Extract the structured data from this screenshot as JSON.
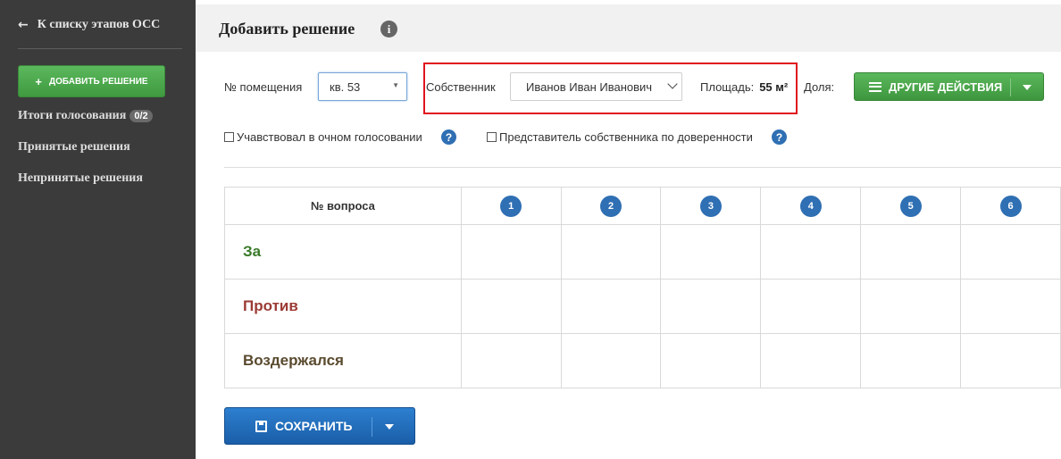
{
  "sidebar": {
    "back_label": "К списку этапов ОСС",
    "add_button_label": "ДОБАВИТЬ РЕШЕНИЕ",
    "items": [
      {
        "label": "Итоги голосования",
        "badge": "0/2"
      },
      {
        "label": "Принятые решения"
      },
      {
        "label": "Непринятые решения"
      }
    ]
  },
  "header": {
    "title": "Добавить решение"
  },
  "form": {
    "room_label": "№ помещения",
    "room_value": "кв. 53",
    "owner_label": "Собственник",
    "owner_value": "Иванов Иван Иванович",
    "area_label": "Площадь:",
    "area_value": "55 м²",
    "share_label": "Доля:",
    "actions_label": "ДРУГИЕ ДЕЙСТВИЯ",
    "checkbox_in_person": "Учавствовал в очном голосовании",
    "checkbox_proxy": "Представитель собственника по доверенности"
  },
  "table": {
    "header_label": "№ вопроса",
    "questions": [
      "1",
      "2",
      "3",
      "4",
      "5",
      "6"
    ],
    "rows": [
      {
        "label": "За"
      },
      {
        "label": "Против"
      },
      {
        "label": "Воздержался"
      }
    ]
  },
  "save_label": "СОХРАНИТЬ",
  "colors": {
    "sidebar_bg": "#3b3b3b",
    "green": "#4cae4c",
    "blue": "#2f6fb3",
    "highlight": "#e0141e"
  }
}
